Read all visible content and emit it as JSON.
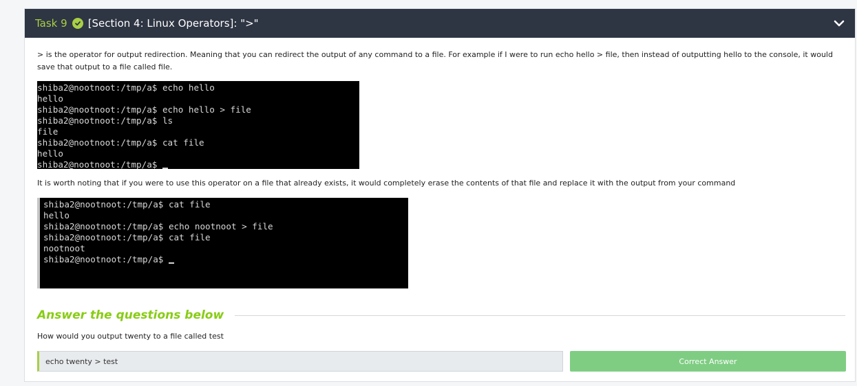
{
  "task": {
    "number_label": "Task 9",
    "title": "[Section 4: Linux Operators]: \">\"",
    "status_icon": "check-circle-icon",
    "collapse_icon": "chevron-down-icon"
  },
  "content": {
    "paragraph1": "> is the operator for output redirection. Meaning that you can redirect the output of any command to a file. For example if I were to run echo hello > file, then instead of outputting hello to the console, it would save that output to a file called file.",
    "terminal1_lines": [
      "shiba2@nootnoot:/tmp/a$ echo hello",
      "hello",
      "shiba2@nootnoot:/tmp/a$ echo hello > file",
      "shiba2@nootnoot:/tmp/a$ ls",
      "file",
      "shiba2@nootnoot:/tmp/a$ cat file",
      "hello",
      "shiba2@nootnoot:/tmp/a$ "
    ],
    "paragraph2": "It is worth noting that if you were to use this operator on a file that already exists, it would completely erase the contents of that file and replace it with the output from your command",
    "terminal2_lines": [
      "shiba2@nootnoot:/tmp/a$ cat file",
      "hello",
      "shiba2@nootnoot:/tmp/a$ echo nootnoot > file",
      "shiba2@nootnoot:/tmp/a$ cat file",
      "nootnoot",
      "shiba2@nootnoot:/tmp/a$ "
    ]
  },
  "questions": {
    "heading": "Answer the questions below",
    "items": [
      {
        "question": "How would you output twenty to a file called test",
        "answer_value": "echo twenty > test",
        "button_label": "Correct Answer"
      }
    ]
  },
  "colors": {
    "header_bg": "#2e3543",
    "accent_green": "#a8cf45",
    "heading_green": "#88cc14",
    "correct_button": "#7fcd83"
  }
}
